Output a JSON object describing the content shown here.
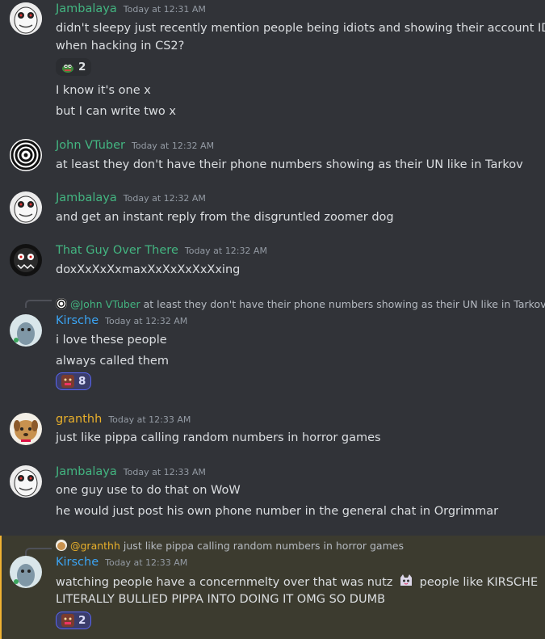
{
  "colors": {
    "background": "#313338",
    "mention_highlight": "#3c3b2f",
    "reaction_active_bg": "#3b3d6b",
    "reaction_active_border": "#5865f2"
  },
  "messages": [
    {
      "author": "Jambalaya",
      "author_color": "#43b581",
      "timestamp": "Today at 12:31 AM",
      "lines": [
        "didn't sleepy just recently mention people being idiots and showing their account IDs",
        "when hacking in CS2?"
      ],
      "reaction": {
        "emoji": "pepe-emoji",
        "count": "2"
      },
      "followups": [
        "I know it's one x",
        "but I can write two x"
      ]
    },
    {
      "author": "John VTuber",
      "author_color": "#43b581",
      "timestamp": "Today at 12:32 AM",
      "lines": [
        "at least they don't have their phone numbers showing as their UN like in Tarkov"
      ]
    },
    {
      "author": "Jambalaya",
      "author_color": "#43b581",
      "timestamp": "Today at 12:32 AM",
      "lines": [
        "and get an instant reply from the disgruntled zoomer dog"
      ]
    },
    {
      "author": "That Guy Over There",
      "author_color": "#43b581",
      "timestamp": "Today at 12:32 AM",
      "lines": [
        "doxXxXxXxmaxXxXxXxXxXxing"
      ]
    },
    {
      "reply_to": {
        "mention": "@John VTuber",
        "text": "at least they don't have their phone numbers showing as their UN like in Tarkov"
      },
      "author": "Kirsche",
      "author_color": "#3ba5f5",
      "timestamp": "Today at 12:32 AM",
      "lines": [
        "i love these people"
      ],
      "followups": [
        "always called them"
      ],
      "reaction": {
        "emoji": "face-emoji",
        "count": "8"
      }
    },
    {
      "author": "granthh",
      "author_color": "#e9b02b",
      "timestamp": "Today at 12:33 AM",
      "lines": [
        "just like pippa calling random numbers in horror games"
      ]
    },
    {
      "author": "Jambalaya",
      "author_color": "#43b581",
      "timestamp": "Today at 12:33 AM",
      "lines": [
        "one guy use to do that on WoW"
      ],
      "followups": [
        "he would just post his own phone number in the general chat in Orgrimmar"
      ]
    },
    {
      "reply_to": {
        "mention": "@granthh",
        "text": "just like pippa calling random numbers in horror games"
      },
      "author": "Kirsche",
      "author_color": "#3ba5f5",
      "timestamp": "Today at 12:33 AM",
      "lines_part1": "watching people have a concernmelty over that was nutz",
      "lines_part2": "people like KIRSCHE",
      "line2": "LITERALLY BULLIED PIPPA INTO DOING IT OMG SO DUMB",
      "reaction": {
        "emoji": "face-emoji",
        "count": "2"
      }
    }
  ]
}
